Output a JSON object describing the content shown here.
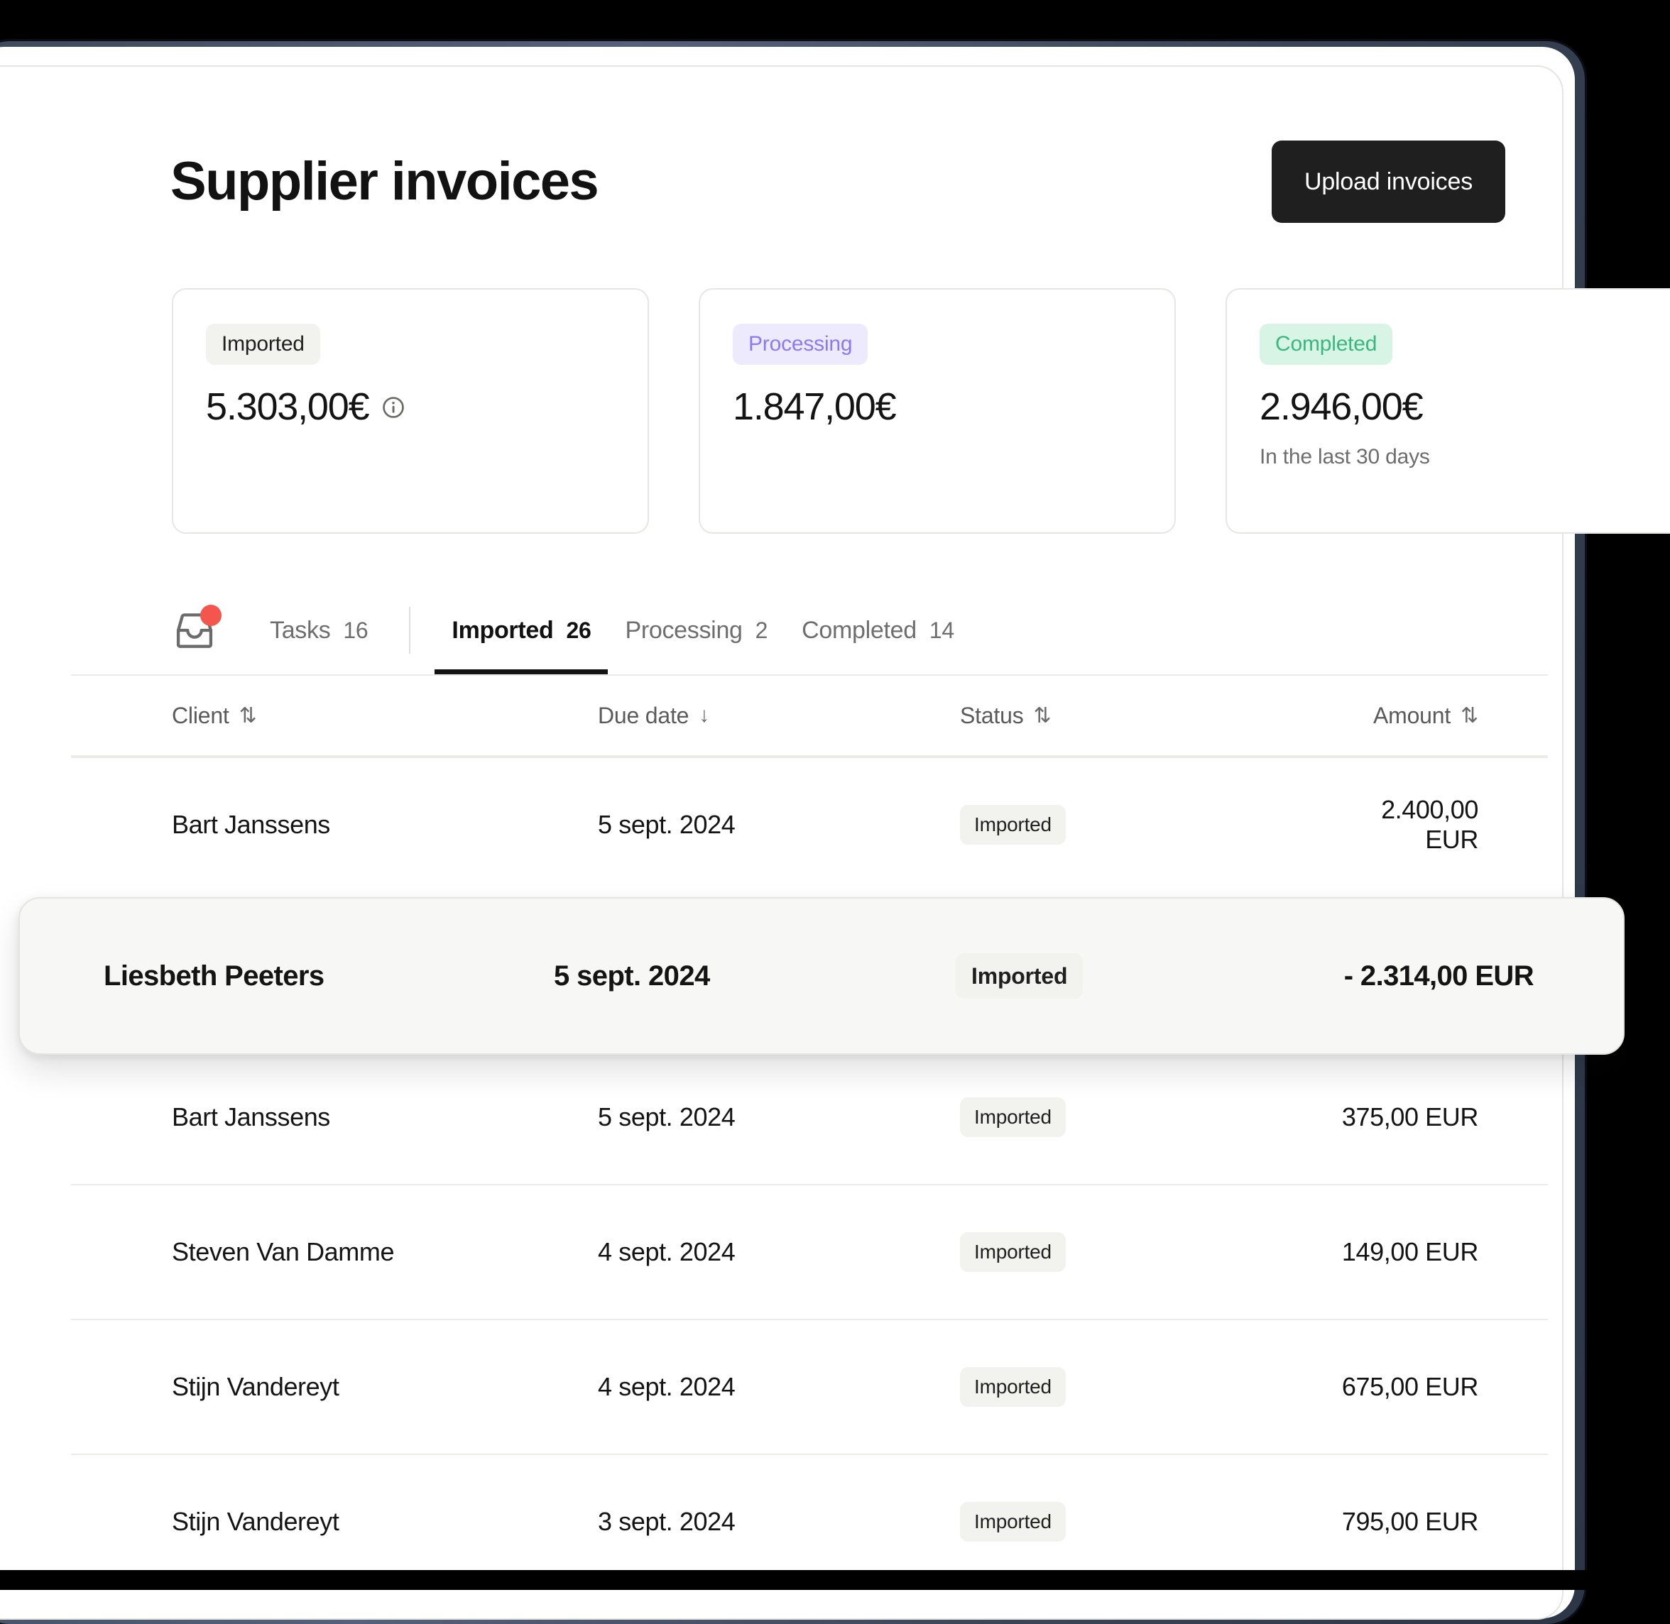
{
  "header": {
    "title": "Supplier invoices",
    "upload_button": "Upload invoices"
  },
  "stats": [
    {
      "badge": "Imported",
      "value": "5.303,00€",
      "sub": "",
      "has_info_icon": true,
      "badge_color": "#1f1f1f",
      "badge_bg": "#f2f2ee"
    },
    {
      "badge": "Processing",
      "value": "1.847,00€",
      "sub": "",
      "has_info_icon": false,
      "badge_color": "#8b7af0",
      "badge_bg": "#eeeafd"
    },
    {
      "badge": "Completed",
      "value": "2.946,00€",
      "sub": "In the last 30 days",
      "has_info_icon": false,
      "badge_color": "#39b77e",
      "badge_bg": "#d8f4e5"
    }
  ],
  "tabs": [
    {
      "label": "Tasks",
      "count": "16",
      "active": false
    },
    {
      "label": "Imported",
      "count": "26",
      "active": true
    },
    {
      "label": "Processing",
      "count": "2",
      "active": false
    },
    {
      "label": "Completed",
      "count": "14",
      "active": false
    }
  ],
  "table": {
    "columns": [
      {
        "label": "Client",
        "sort": "⇅"
      },
      {
        "label": "Due date",
        "sort": "↓"
      },
      {
        "label": "Status",
        "sort": "⇅"
      },
      {
        "label": "Amount",
        "sort": "⇅"
      }
    ],
    "rows": [
      {
        "client": "Bart Janssens",
        "due_date": "5 sept. 2024",
        "status": "Imported",
        "amount": "2.400,00 EUR"
      },
      {
        "client": "Bart Janssens",
        "due_date": "5 sept. 2024",
        "status": "Imported",
        "amount": "375,00 EUR"
      },
      {
        "client": "Steven Van Damme",
        "due_date": "4 sept. 2024",
        "status": "Imported",
        "amount": "149,00 EUR"
      },
      {
        "client": "Stijn Vandereyt",
        "due_date": "4 sept. 2024",
        "status": "Imported",
        "amount": "675,00 EUR"
      },
      {
        "client": "Stijn Vandereyt",
        "due_date": "3 sept. 2024",
        "status": "Imported",
        "amount": "795,00 EUR"
      }
    ],
    "highlighted_row": {
      "client": "Liesbeth Peeters",
      "due_date": "5 sept. 2024",
      "status": "Imported",
      "amount": "- 2.314,00 EUR"
    }
  },
  "icons": {
    "inbox": "inbox-icon",
    "notification_dot_color": "#f4564e",
    "info": "info-circle-icon"
  }
}
